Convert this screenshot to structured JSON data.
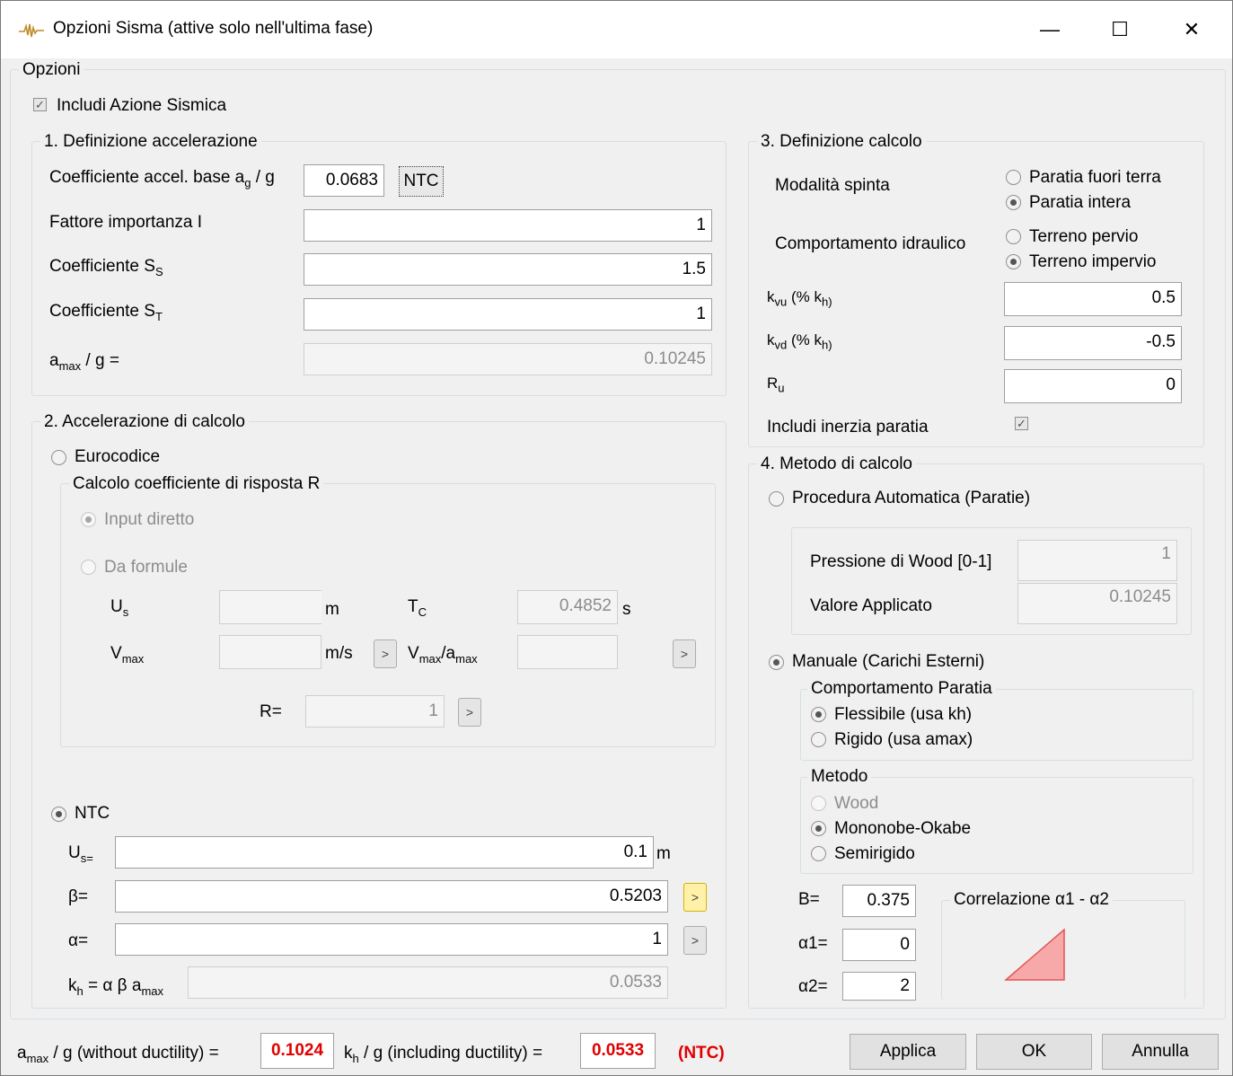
{
  "window": {
    "title": "Opzioni Sisma (attive solo nell'ultima fase)",
    "minimize_glyph": "—",
    "maximize_glyph": "☐",
    "close_glyph": "✕"
  },
  "options": {
    "group_label": "Opzioni",
    "include_seismic_label": "Includi Azione Sismica",
    "include_seismic_checked": true
  },
  "sec1": {
    "title": "1. Definizione accelerazione",
    "coef_label": "Coefficiente accel. base a",
    "coef_sub": "g",
    "coef_suffix": " / g",
    "coef_value": "0.0683",
    "ntc_button": "NTC",
    "importance_label": "Fattore importanza I",
    "importance_value": "1",
    "ss_label": "Coefficiente S",
    "ss_sub": "S",
    "ss_value": "1.5",
    "st_label": "Coefficiente S",
    "st_sub": "T",
    "st_value": "1",
    "amax_label": "a",
    "amax_sub": "max",
    "amax_suffix": " / g =",
    "amax_value": "0.10245"
  },
  "sec2": {
    "title": "2. Accelerazione di calcolo",
    "eurocodice_label": "Eurocodice",
    "eurocodice_selected": false,
    "risposta_title": "Calcolo coefficiente di risposta R",
    "input_diretto_label": "Input diretto",
    "da_formule_label": "Da formule",
    "us_label": "U",
    "us_sub": "s",
    "us_unit": "m",
    "tc_label": "T",
    "tc_sub": "C",
    "tc_value": "0.4852",
    "tc_unit": "s",
    "vmax_label": "V",
    "vmax_sub": "max",
    "vmax_unit": "m/s",
    "vmax_amax_label": "V",
    "vmax_amax_sub1": "max",
    "vmax_amax_mid": "/a",
    "vmax_amax_sub2": "max",
    "r_label": "R=",
    "r_value": "1",
    "arrow": ">",
    "ntc_label": "NTC",
    "ntc_selected": true,
    "ntc_us_label": "U",
    "ntc_us_sub": "s=",
    "ntc_us_value": "0.1",
    "ntc_us_unit": "m",
    "beta_label": "β=",
    "beta_value": "0.5203",
    "alpha_label": "α=",
    "alpha_value": "1",
    "kh_label": "k",
    "kh_sub": "h",
    "kh_mid": " = α β a",
    "kh_sub2": "max",
    "kh_value": "0.0533"
  },
  "sec3": {
    "title": "3. Definizione calcolo",
    "spinta_label": "Modalità spinta",
    "fuori_terra_label": "Paratia fuori terra",
    "intera_label": "Paratia intera",
    "idraulico_label": "Comportamento idraulico",
    "pervio_label": "Terreno pervio",
    "impervio_label": "Terreno impervio",
    "kvu_label": "k",
    "kvu_sub": "vu",
    "kvu_mid": " (% k",
    "kvu_sub2": "h)",
    "kvu_value": "0.5",
    "kvd_label": "k",
    "kvd_sub": "vd",
    "kvd_mid": " (% k",
    "kvd_sub2": "h)",
    "kvd_value": "-0.5",
    "ru_label": "R",
    "ru_sub": "u",
    "ru_value": "0",
    "inerzia_label": "Includi inerzia paratia",
    "inerzia_checked": true
  },
  "sec4": {
    "title": "4. Metodo di calcolo",
    "auto_label": "Procedura Automatica (Paratie)",
    "wood_pressure_label": "Pressione di Wood [0-1]",
    "wood_pressure_value": "1",
    "applied_label": "Valore Applicato",
    "applied_value": "0.10245",
    "manual_label": "Manuale (Carichi Esterni)",
    "comportamento_title": "Comportamento Paratia",
    "flessibile_label": "Flessibile (usa kh)",
    "rigido_label": "Rigido (usa amax)",
    "metodo_title": "Metodo",
    "wood_label": "Wood",
    "mononobe_label": "Mononobe-Okabe",
    "semirigido_label": "Semirigido",
    "b_label": "B=",
    "b_value": "0.375",
    "a1_label": "α1=",
    "a1_value": "0",
    "a2_label": "α2=",
    "a2_value": "2",
    "correlazione_title": "Correlazione α1 - α2"
  },
  "footer": {
    "amax_label": "a",
    "amax_sub": "max",
    "amax_suffix": " / g (without ductility) =",
    "amax_value": "0.1024",
    "kh_label": "k",
    "kh_sub": "h",
    "kh_suffix": " / g (including ductility) =",
    "kh_value": "0.0533",
    "ntc_tag": "(NTC)",
    "apply_button": "Applica",
    "ok_button": "OK",
    "cancel_button": "Annulla"
  },
  "colors": {
    "accent_red": "#e00000",
    "highlight_yellow": "#fff2a8",
    "triangle_fill": "#f7a9a9"
  }
}
